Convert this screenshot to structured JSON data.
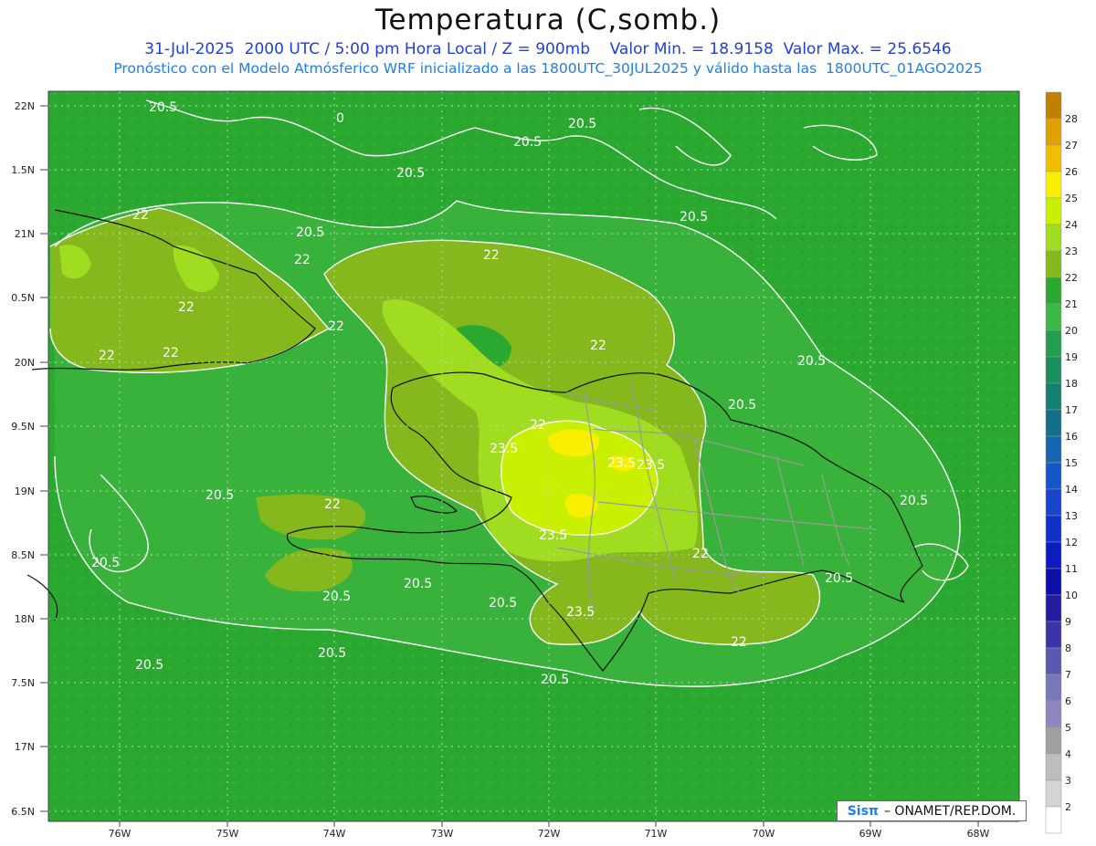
{
  "header": {
    "title": "Temperatura (C,somb.)",
    "line1": "31-Jul-2025  2000 UTC / 5:00 pm Hora Local / Z = 900mb    Valor Min. = 18.9158  Valor Max. = 25.6546",
    "line2": "Pronóstico con el Modelo Atmósferico WRF inicializado a las 1800UTC_30JUL2025 y válido hasta las  1800UTC_01AGO2025"
  },
  "axes": {
    "lat_labels": [
      "22N",
      "1.5N",
      "21N",
      "0.5N",
      "20N",
      "9.5N",
      "19N",
      "8.5N",
      "18N",
      "7.5N",
      "17N",
      "6.5N"
    ],
    "lon_labels": [
      "76W",
      "75W",
      "74W",
      "73W",
      "72W",
      "71W",
      "70W",
      "69W",
      "68W"
    ]
  },
  "colorbar": {
    "labels": [
      "28",
      "27",
      "26",
      "25",
      "24",
      "23",
      "22",
      "21",
      "20",
      "19",
      "18",
      "17",
      "16",
      "15",
      "14",
      "13",
      "12",
      "11",
      "10",
      "9",
      "8",
      "7",
      "6",
      "5",
      "4",
      "3",
      "2"
    ],
    "colors": [
      "#c08000",
      "#e0a000",
      "#f0c000",
      "#f8f000",
      "#c8f000",
      "#a0dc20",
      "#84b81c",
      "#2aa830",
      "#3cb848",
      "#22a050",
      "#1a8f60",
      "#138070",
      "#0f7088",
      "#1466b0",
      "#1458c8",
      "#1844d0",
      "#1030c8",
      "#0c1cc0",
      "#0e0ea8",
      "#221ca0",
      "#3a34a8",
      "#5a58b0",
      "#7a78b8",
      "#8e86bc",
      "#a0a0a0",
      "#bdbdbd",
      "#d4d4d4",
      "#ffffff"
    ]
  },
  "contour_labels": [
    "20.5",
    "20.5",
    "20.5",
    "20.5",
    "20.5",
    "20.5",
    "20.5",
    "20.5",
    "20.5",
    "20.5",
    "20.5",
    "20.5",
    "20.5",
    "20.5",
    "20.5",
    "20.5",
    "22",
    "22",
    "22",
    "22",
    "22",
    "22",
    "22",
    "22",
    "22",
    "22",
    "22",
    "22",
    "23.5",
    "23.5",
    "23.5",
    "23.5",
    "23.5",
    "0",
    "20.5",
    "20.5"
  ],
  "credit": {
    "logo": "Sisπ",
    "text": "– ONAMET/REP.DOM."
  }
}
